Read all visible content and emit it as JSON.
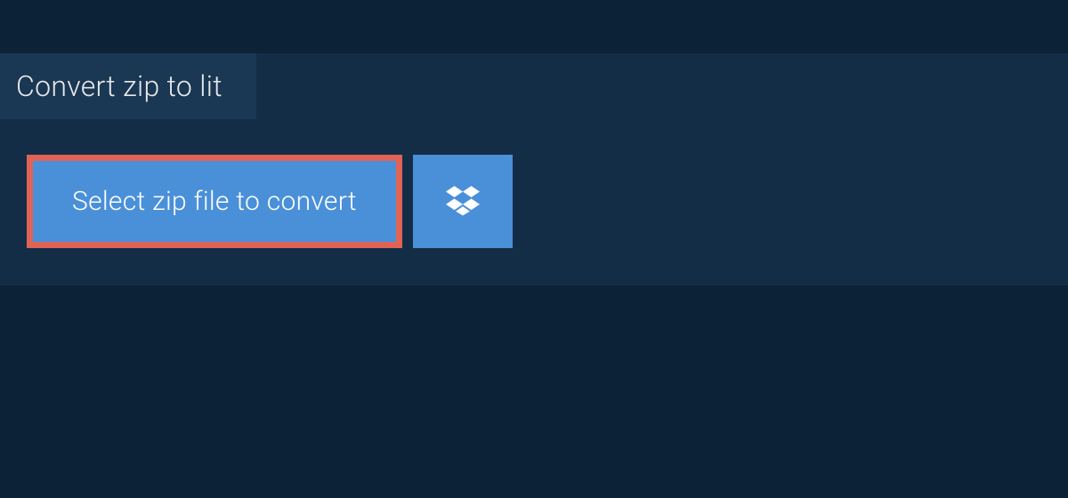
{
  "tab": {
    "title": "Convert zip to lit"
  },
  "actions": {
    "select_file_label": "Select zip file to convert",
    "dropbox_icon": "dropbox-icon"
  },
  "colors": {
    "page_bg": "#0c2237",
    "panel_bg": "#142d47",
    "tab_bg": "#1a3753",
    "button_bg": "#4a90d9",
    "highlight_border": "#e06356",
    "text_light": "#e6e8ea"
  }
}
